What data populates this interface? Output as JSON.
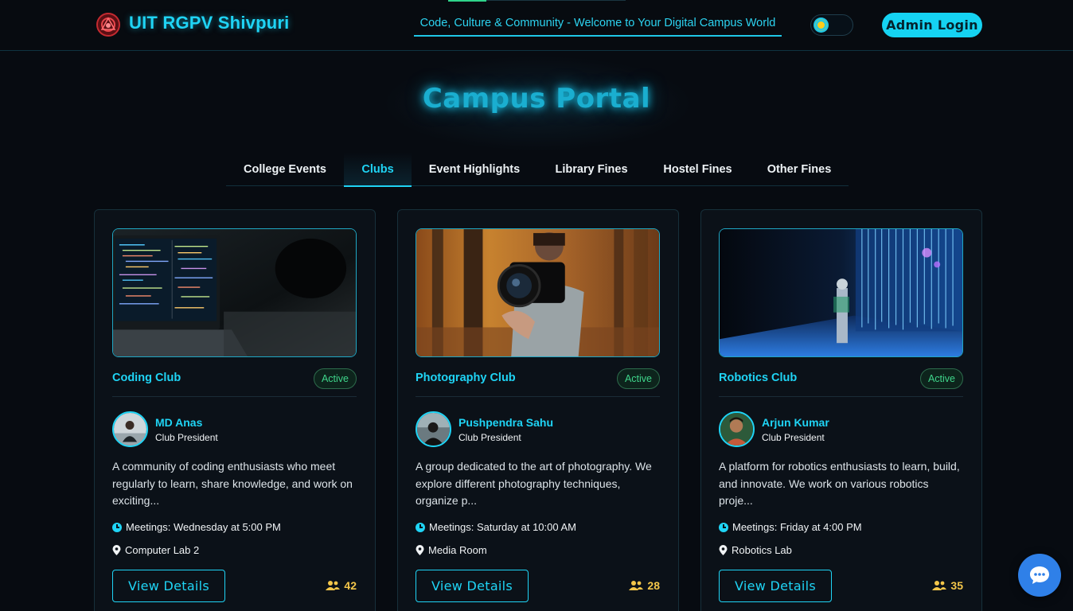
{
  "header": {
    "brand": "UIT RGPV Shivpuri",
    "tagline": "Code, Culture & Community - Welcome to Your Digital Campus World",
    "admin_label": "Admin Login",
    "accent": "#1fd4f5"
  },
  "page_title": "Campus Portal",
  "tabs": [
    {
      "label": "College Events",
      "active": false
    },
    {
      "label": "Clubs",
      "active": true
    },
    {
      "label": "Event Highlights",
      "active": false
    },
    {
      "label": "Library Fines",
      "active": false
    },
    {
      "label": "Hostel Fines",
      "active": false
    },
    {
      "label": "Other Fines",
      "active": false
    }
  ],
  "clubs": [
    {
      "name": "Coding Club",
      "status": "Active",
      "president": "MD Anas",
      "role": "Club President",
      "description": "A community of coding enthusiasts who meet regularly to learn, share knowledge, and work on exciting...",
      "meetings": "Meetings: Wednesday at 5:00 PM",
      "location": "Computer Lab 2",
      "button": "View Details",
      "members": "42"
    },
    {
      "name": "Photography Club",
      "status": "Active",
      "president": "Pushpendra Sahu",
      "role": "Club President",
      "description": "A group dedicated to the art of photography. We explore different photography techniques, organize p...",
      "meetings": "Meetings: Saturday at 10:00 AM",
      "location": "Media Room",
      "button": "View Details",
      "members": "28"
    },
    {
      "name": "Robotics Club",
      "status": "Active",
      "president": "Arjun Kumar",
      "role": "Club President",
      "description": "A platform for robotics enthusiasts to learn, build, and innovate. We work on various robotics proje...",
      "meetings": "Meetings: Friday at 4:00 PM",
      "location": "Robotics Lab",
      "button": "View Details",
      "members": "35"
    }
  ],
  "icons": {
    "theme": "sun-icon",
    "meeting": "clock-icon",
    "location": "map-pin-icon",
    "members": "users-icon",
    "chat": "chat-bubble-icon"
  }
}
